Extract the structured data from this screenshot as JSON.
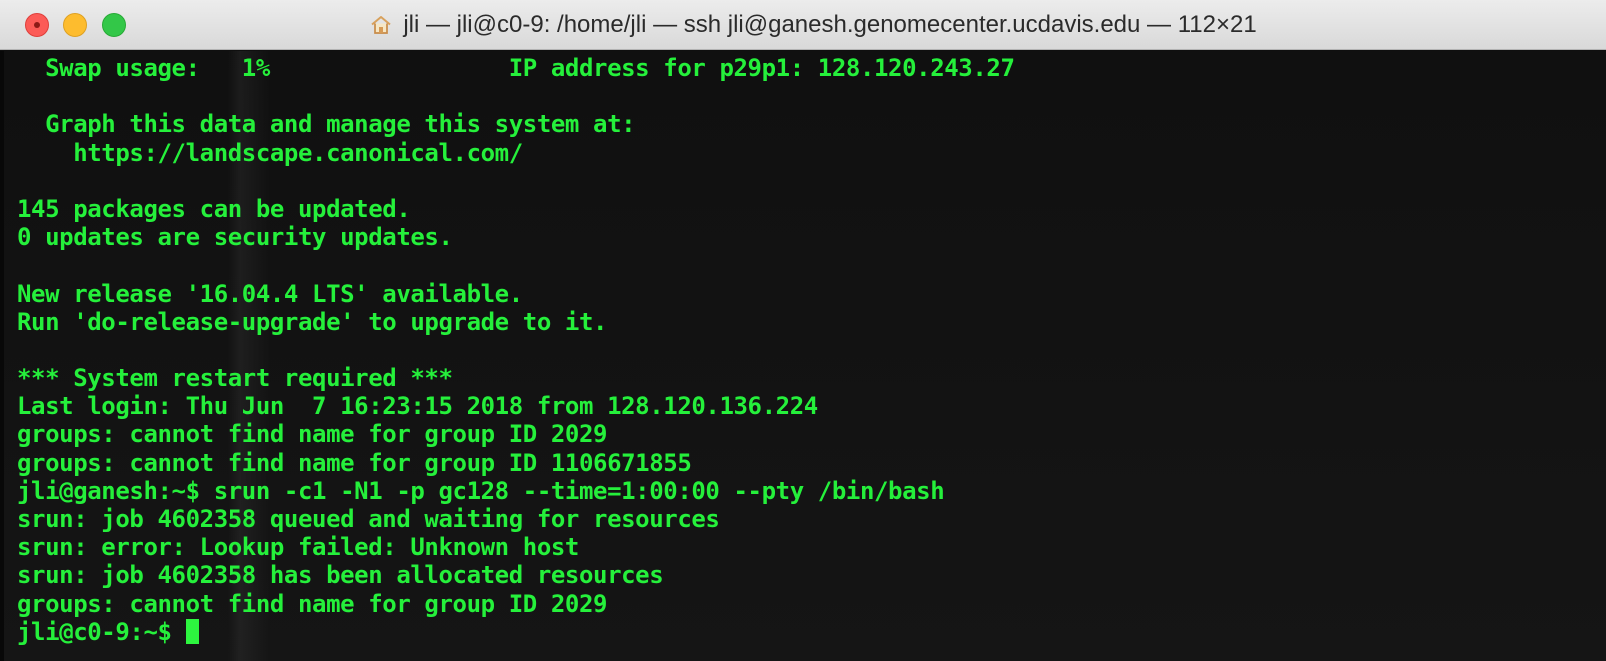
{
  "window": {
    "title": "jli — jli@c0-9: /home/jli — ssh jli@ganesh.genomecenter.ucdavis.edu — 112×21",
    "title_icon": "home-icon",
    "buttons": {
      "close": "close-button",
      "minimize": "minimize-button",
      "zoom": "zoom-button"
    },
    "colors": {
      "titlebar": "#e5e5e5",
      "terminal_background": "#0f0f0f",
      "terminal_text": "#25f03b",
      "close": "#fc5b57",
      "minimize": "#fdbc2e",
      "zoom": "#33c748"
    }
  },
  "terminal": {
    "lines": [
      "  Swap usage:   1%                 IP address for p29p1: 128.120.243.27",
      "",
      "  Graph this data and manage this system at:",
      "    https://landscape.canonical.com/",
      "",
      "145 packages can be updated.",
      "0 updates are security updates.",
      "",
      "New release '16.04.4 LTS' available.",
      "Run 'do-release-upgrade' to upgrade to it.",
      "",
      "*** System restart required ***",
      "Last login: Thu Jun  7 16:23:15 2018 from 128.120.136.224",
      "groups: cannot find name for group ID 2029",
      "groups: cannot find name for group ID 1106671855",
      "jli@ganesh:~$ srun -c1 -N1 -p gc128 --time=1:00:00 --pty /bin/bash",
      "srun: job 4602358 queued and waiting for resources",
      "srun: error: Lookup failed: Unknown host",
      "srun: job 4602358 has been allocated resources",
      "groups: cannot find name for group ID 2029",
      "jli@c0-9:~$ "
    ]
  }
}
